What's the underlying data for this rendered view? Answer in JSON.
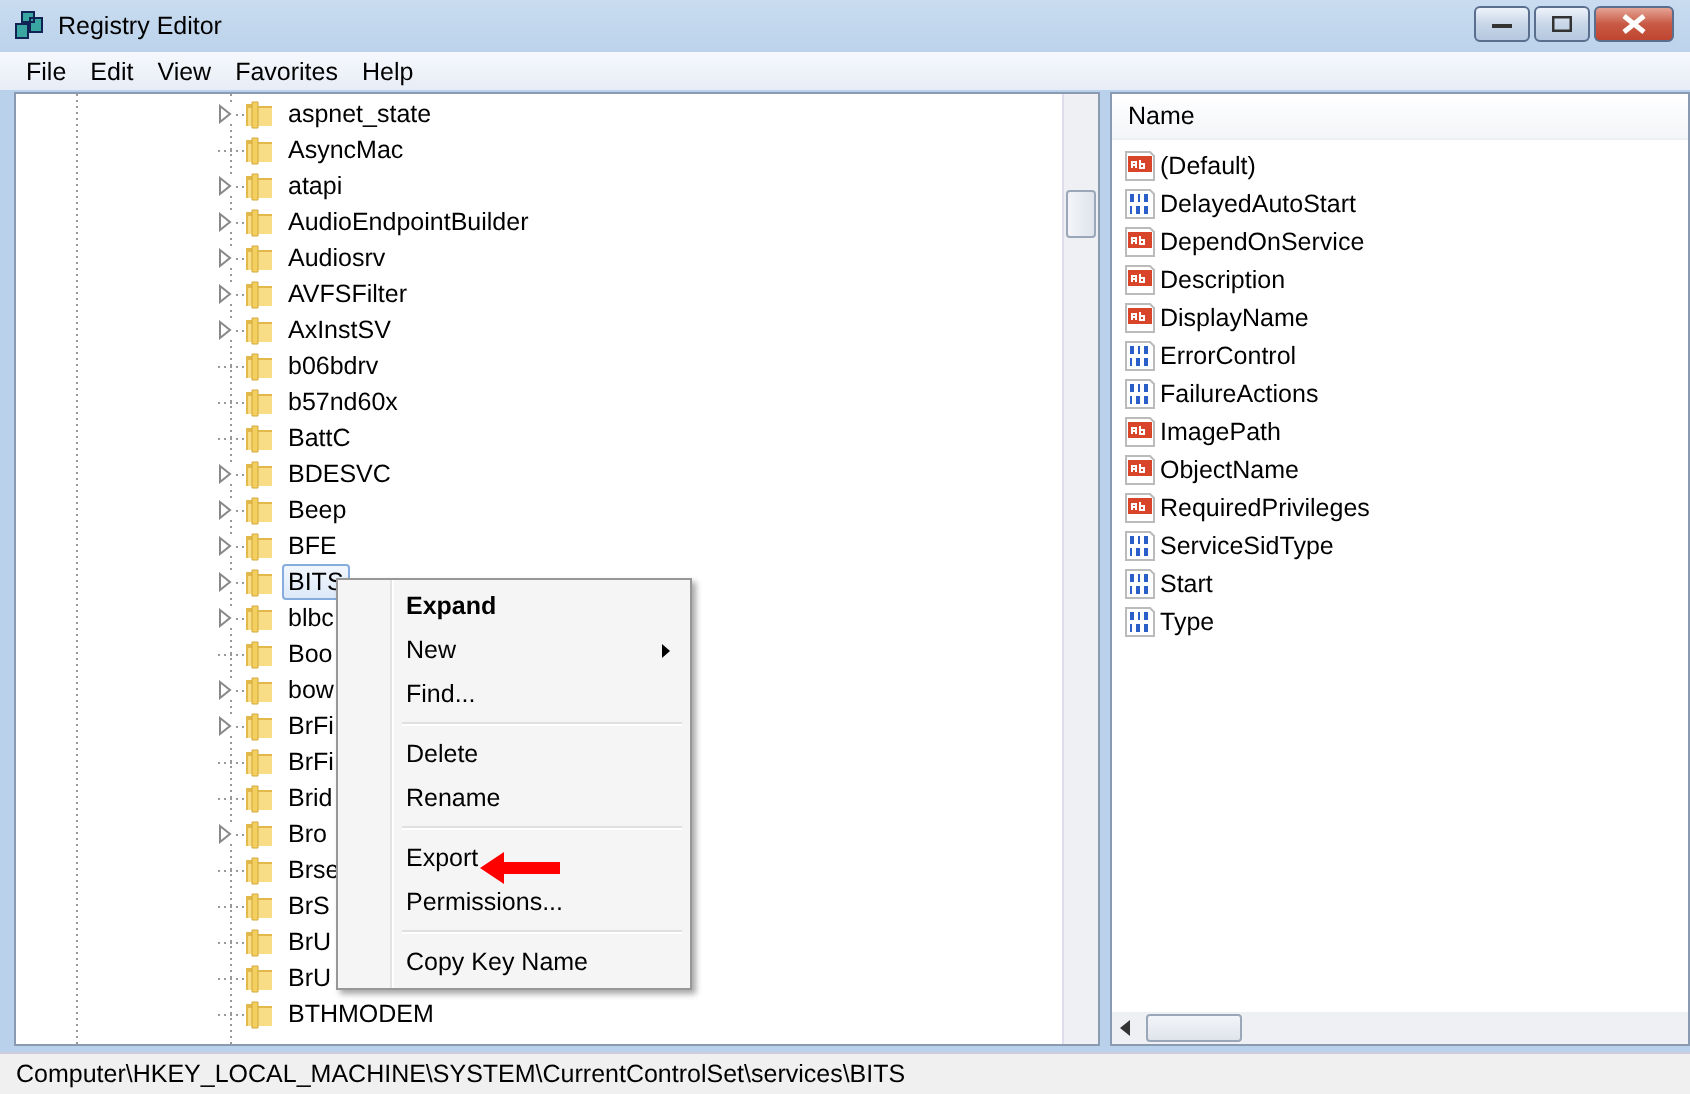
{
  "window": {
    "title": "Registry Editor"
  },
  "menu_bar": [
    {
      "label": "File"
    },
    {
      "label": "Edit"
    },
    {
      "label": "View"
    },
    {
      "label": "Favorites"
    },
    {
      "label": "Help"
    }
  ],
  "tree": {
    "items": [
      {
        "label": "aspnet_state",
        "has_children": true,
        "selected": false
      },
      {
        "label": "AsyncMac",
        "has_children": false,
        "selected": false
      },
      {
        "label": "atapi",
        "has_children": true,
        "selected": false
      },
      {
        "label": "AudioEndpointBuilder",
        "has_children": true,
        "selected": false
      },
      {
        "label": "Audiosrv",
        "has_children": true,
        "selected": false
      },
      {
        "label": "AVFSFilter",
        "has_children": true,
        "selected": false
      },
      {
        "label": "AxInstSV",
        "has_children": true,
        "selected": false
      },
      {
        "label": "b06bdrv",
        "has_children": false,
        "selected": false
      },
      {
        "label": "b57nd60x",
        "has_children": false,
        "selected": false
      },
      {
        "label": "BattC",
        "has_children": false,
        "selected": false
      },
      {
        "label": "BDESVC",
        "has_children": true,
        "selected": false
      },
      {
        "label": "Beep",
        "has_children": true,
        "selected": false
      },
      {
        "label": "BFE",
        "has_children": true,
        "selected": false
      },
      {
        "label": "BITS",
        "has_children": true,
        "selected": true
      },
      {
        "label": "blbc",
        "has_children": true,
        "selected": false
      },
      {
        "label": "Boo",
        "has_children": false,
        "selected": false
      },
      {
        "label": "bow",
        "has_children": true,
        "selected": false
      },
      {
        "label": "BrFi",
        "has_children": true,
        "selected": false
      },
      {
        "label": "BrFi",
        "has_children": false,
        "selected": false
      },
      {
        "label": "Brid",
        "has_children": false,
        "selected": false
      },
      {
        "label": "Bro",
        "has_children": true,
        "selected": false
      },
      {
        "label": "Brse",
        "has_children": false,
        "selected": false
      },
      {
        "label": "BrS",
        "has_children": false,
        "selected": false
      },
      {
        "label": "BrU",
        "has_children": false,
        "selected": false
      },
      {
        "label": "BrU",
        "has_children": false,
        "selected": false
      },
      {
        "label": "BTHMODEM",
        "has_children": false,
        "selected": false
      }
    ]
  },
  "values": {
    "column": "Name",
    "rows": [
      {
        "name": "(Default)",
        "kind": "string"
      },
      {
        "name": "DelayedAutoStart",
        "kind": "dword"
      },
      {
        "name": "DependOnService",
        "kind": "string"
      },
      {
        "name": "Description",
        "kind": "string"
      },
      {
        "name": "DisplayName",
        "kind": "string"
      },
      {
        "name": "ErrorControl",
        "kind": "dword"
      },
      {
        "name": "FailureActions",
        "kind": "dword"
      },
      {
        "name": "ImagePath",
        "kind": "string"
      },
      {
        "name": "ObjectName",
        "kind": "string"
      },
      {
        "name": "RequiredPrivileges",
        "kind": "string"
      },
      {
        "name": "ServiceSidType",
        "kind": "dword"
      },
      {
        "name": "Start",
        "kind": "dword"
      },
      {
        "name": "Type",
        "kind": "dword"
      }
    ]
  },
  "context_menu": {
    "items": [
      {
        "kind": "item",
        "label": "Expand",
        "bold": true,
        "submenu": false
      },
      {
        "kind": "item",
        "label": "New",
        "bold": false,
        "submenu": true
      },
      {
        "kind": "item",
        "label": "Find...",
        "bold": false,
        "submenu": false
      },
      {
        "kind": "separator"
      },
      {
        "kind": "item",
        "label": "Delete",
        "bold": false,
        "submenu": false
      },
      {
        "kind": "item",
        "label": "Rename",
        "bold": false,
        "submenu": false
      },
      {
        "kind": "separator"
      },
      {
        "kind": "item",
        "label": "Export",
        "bold": false,
        "submenu": false
      },
      {
        "kind": "item",
        "label": "Permissions...",
        "bold": false,
        "submenu": false
      },
      {
        "kind": "separator"
      },
      {
        "kind": "item",
        "label": "Copy Key Name",
        "bold": false,
        "submenu": false
      }
    ]
  },
  "status_bar": "Computer\\HKEY_LOCAL_MACHINE\\SYSTEM\\CurrentControlSet\\services\\BITS"
}
